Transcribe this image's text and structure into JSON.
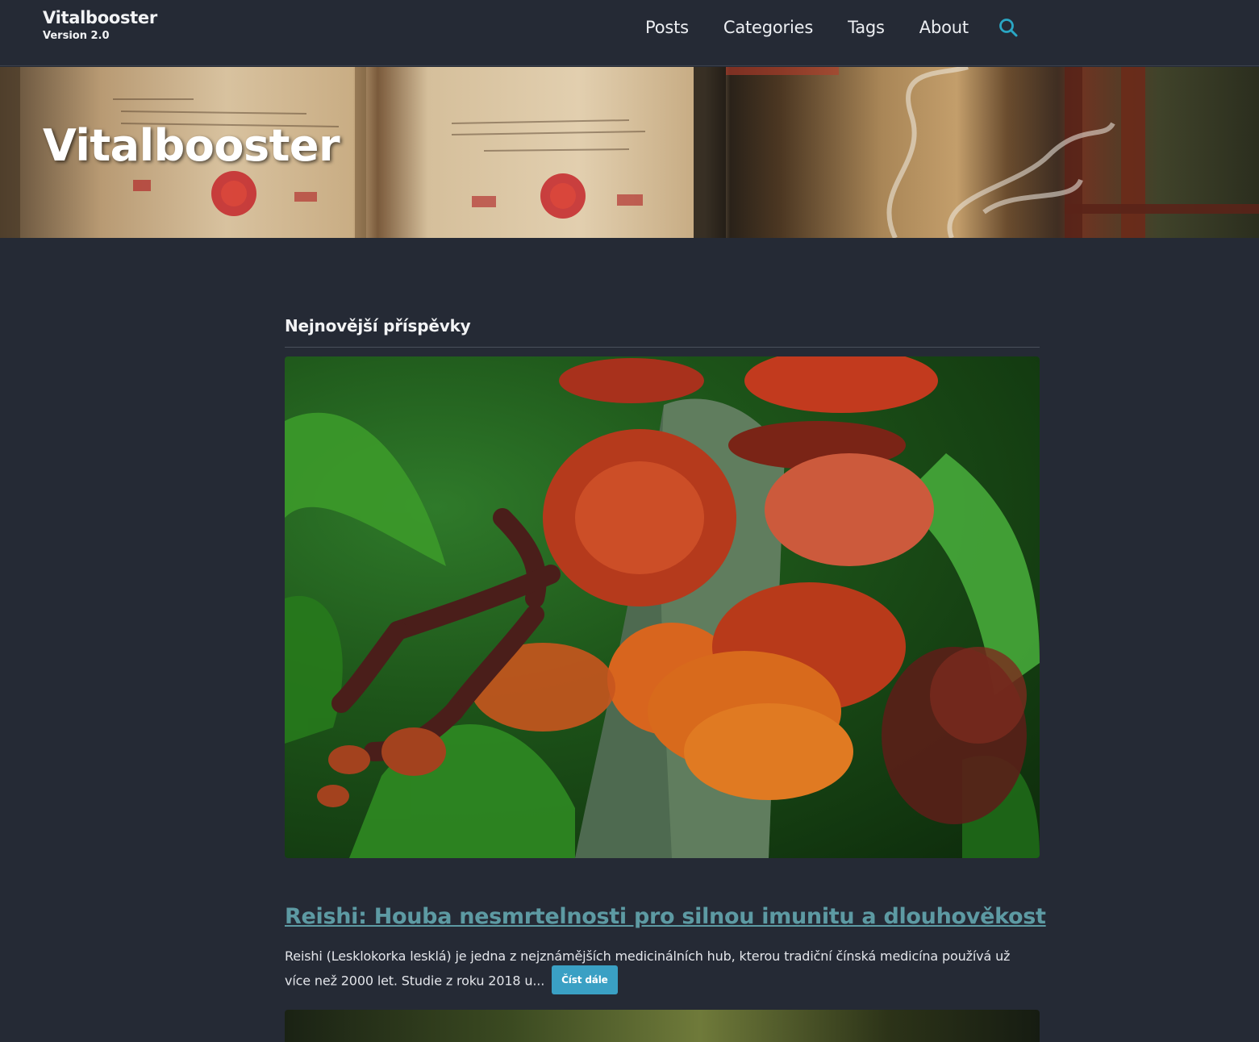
{
  "header": {
    "brand_title": "Vitalbooster",
    "brand_version": "Version 2.0",
    "nav": [
      {
        "label": "Posts"
      },
      {
        "label": "Categories"
      },
      {
        "label": "Tags"
      },
      {
        "label": "About"
      }
    ],
    "search_icon": "search-icon",
    "accent_color": "#2aa7c4"
  },
  "hero": {
    "title": "Vitalbooster"
  },
  "main": {
    "section_heading": "Nejnovější příspěvky",
    "posts": [
      {
        "title": "Reishi: Houba nesmrtelnosti pro silnou imunitu a dlouhověkost",
        "excerpt": "Reishi (Lesklokorka lesklá) je jedna z nejznámějších medicinálních hub, kterou tradiční čínská medicína používá už více než 2000 let. Studie z roku 2018 u...",
        "read_more": "Číst dále"
      }
    ]
  },
  "colors": {
    "background": "#252a35",
    "link": "#5d9aa3",
    "button": "#3aa0c4"
  }
}
